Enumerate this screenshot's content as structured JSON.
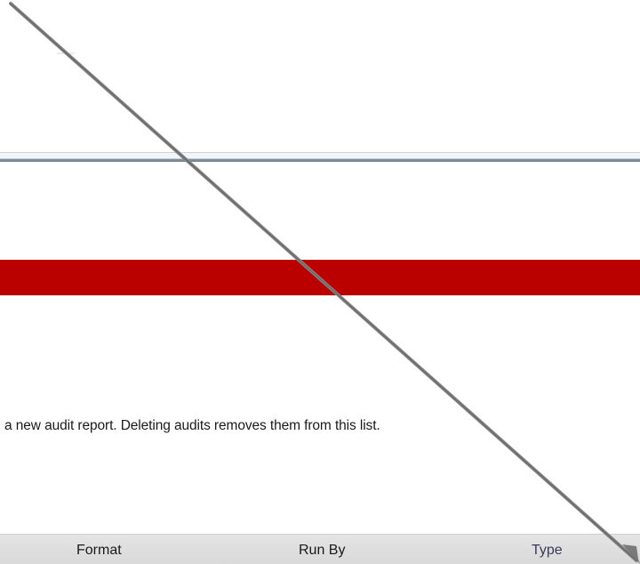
{
  "info": {
    "text": "a new audit report. Deleting audits removes them from this list."
  },
  "table": {
    "columns": [
      "Format",
      "Run By",
      "Type"
    ]
  },
  "colors": {
    "banner": "#bb0000",
    "header_bg": "#dedede",
    "annotation_stroke": "#707070"
  },
  "annotation": {
    "icon": "arrow-icon"
  }
}
